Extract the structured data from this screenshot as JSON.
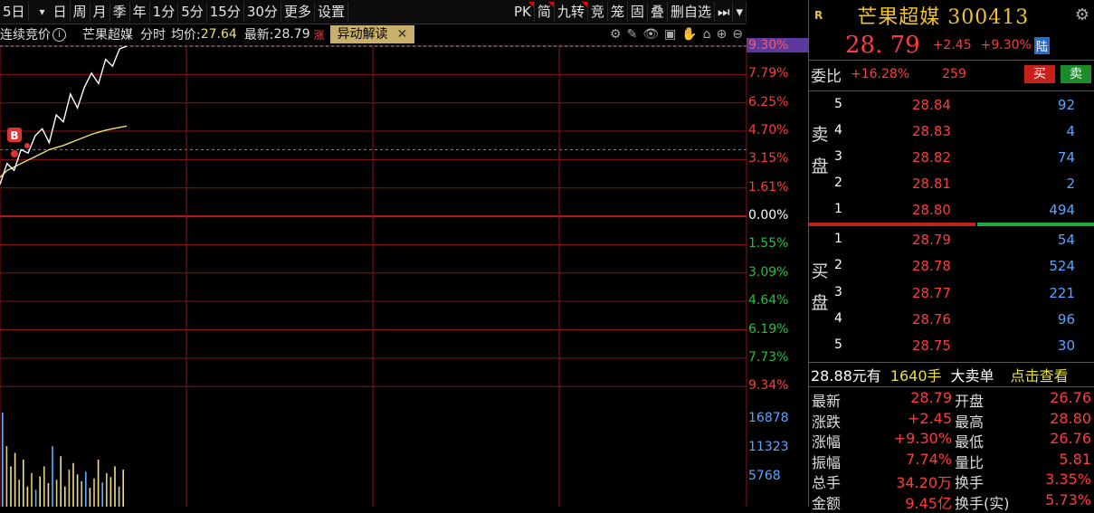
{
  "toolbar": {
    "left_items": [
      "5日",
      "日",
      "周",
      "月",
      "季",
      "年",
      "1分",
      "5分",
      "15分",
      "30分",
      "更多",
      "设置"
    ],
    "right_items": [
      "PK",
      "简",
      "九转",
      "竞",
      "笼",
      "固",
      "叠",
      "删自选"
    ],
    "play_icon": "skip-next-icon",
    "menu_icon": "dropdown-arrow-icon"
  },
  "infobar": {
    "mode": "连续竞价",
    "info_icon": "info-icon",
    "stock_name": "芒果超媒",
    "type": "分时",
    "avg_label": "均价:",
    "avg_value": "27.64",
    "last_label": "最新:",
    "last_value": "28.79",
    "trunc_char": "涨",
    "yidong": "异动解读",
    "close_x": "✕"
  },
  "chart_data": {
    "type": "line",
    "title": "",
    "price_axis_labels": [
      "9.30%",
      "7.79%",
      "6.25%",
      "4.70%",
      "3.15%",
      "1.61%",
      "0.00%",
      "1.55%",
      "3.09%",
      "4.64%",
      "6.19%",
      "7.73%",
      "9.34%"
    ],
    "volume_axis_labels": [
      "16878",
      "11323",
      "5768"
    ],
    "base_close": 26.34,
    "series": [
      {
        "name": "最新",
        "values": [
          26.8,
          27.1,
          27.0,
          27.3,
          27.25,
          27.5,
          27.6,
          27.4,
          27.8,
          27.7,
          28.1,
          27.9,
          28.2,
          28.4,
          28.25,
          28.6,
          28.5,
          28.75,
          28.79
        ]
      },
      {
        "name": "均价",
        "values": [
          26.9,
          27.0,
          27.05,
          27.1,
          27.15,
          27.2,
          27.25,
          27.3,
          27.33,
          27.36,
          27.4,
          27.44,
          27.48,
          27.52,
          27.55,
          27.58,
          27.6,
          27.62,
          27.64
        ]
      }
    ],
    "volumes": [
      14000,
      9000,
      6000,
      8000,
      4000,
      7000,
      3000,
      5000,
      2500,
      4500,
      6000,
      3500,
      9000,
      4000,
      7500,
      3000,
      5500,
      6500,
      4800,
      3800,
      5200,
      2800,
      4200,
      7000,
      3600,
      5000,
      4400,
      6000,
      3000,
      5500
    ],
    "buy_marker": "B"
  },
  "quote": {
    "r_badge": "R",
    "title": "芒果超媒 300413",
    "gear_icon": "gear-icon",
    "price": "28. 79",
    "change": "+2.45",
    "pct": "+9.30%",
    "lu": "陆",
    "weibi_label": "委比",
    "weibi_pct": "+16.28%",
    "weibi_diff": "259",
    "buy_label": "买",
    "sell_label": "卖",
    "ask_side": [
      "卖",
      "盘"
    ],
    "bid_side": [
      "买",
      "盘"
    ],
    "asks": [
      {
        "lv": "5",
        "px": "28.84",
        "vol": "92"
      },
      {
        "lv": "4",
        "px": "28.83",
        "vol": "4"
      },
      {
        "lv": "3",
        "px": "28.82",
        "vol": "74"
      },
      {
        "lv": "2",
        "px": "28.81",
        "vol": "2"
      },
      {
        "lv": "1",
        "px": "28.80",
        "vol": "494"
      }
    ],
    "bids": [
      {
        "lv": "1",
        "px": "28.79",
        "vol": "54"
      },
      {
        "lv": "2",
        "px": "28.78",
        "vol": "524"
      },
      {
        "lv": "3",
        "px": "28.77",
        "vol": "221"
      },
      {
        "lv": "4",
        "px": "28.76",
        "vol": "96"
      },
      {
        "lv": "5",
        "px": "28.75",
        "vol": "30"
      }
    ],
    "big_order": {
      "price": "28.88元有",
      "qty": "1640手",
      "label": "大卖单",
      "link": "点击查看"
    },
    "stats": [
      {
        "l1": "最新",
        "v1": "28.79",
        "l2": "开盘",
        "v2": "26.76"
      },
      {
        "l1": "涨跌",
        "v1": "+2.45",
        "l2": "最高",
        "v2": "28.80"
      },
      {
        "l1": "涨幅",
        "v1": "+9.30%",
        "l2": "最低",
        "v2": "26.76"
      },
      {
        "l1": "振幅",
        "v1": "7.74%",
        "l2": "量比",
        "v2": "5.81"
      },
      {
        "l1": "总手",
        "v1": "34.20万",
        "l2": "换手",
        "v2": "3.35%"
      },
      {
        "l1": "金额",
        "v1": "9.45亿",
        "l2": "换手(实)",
        "v2": "5.73%"
      }
    ]
  },
  "colors": {
    "grid_red": "#8b1414",
    "price_line": "#ffffff",
    "avg_line": "#e8e070",
    "up_red": "#ff3b3b",
    "down_green": "#22c03a",
    "accent_purple": "#5a3aa0",
    "vol_blue": "#58a6ff"
  }
}
